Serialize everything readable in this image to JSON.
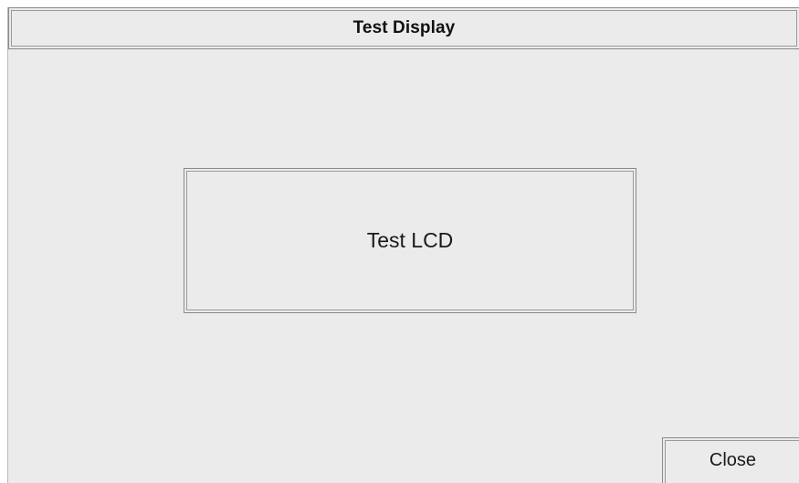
{
  "window": {
    "title": "Test Display",
    "background": "#ebebeb"
  },
  "main": {
    "test_lcd_label": "Test LCD"
  },
  "footer": {
    "close_label": "Close"
  }
}
